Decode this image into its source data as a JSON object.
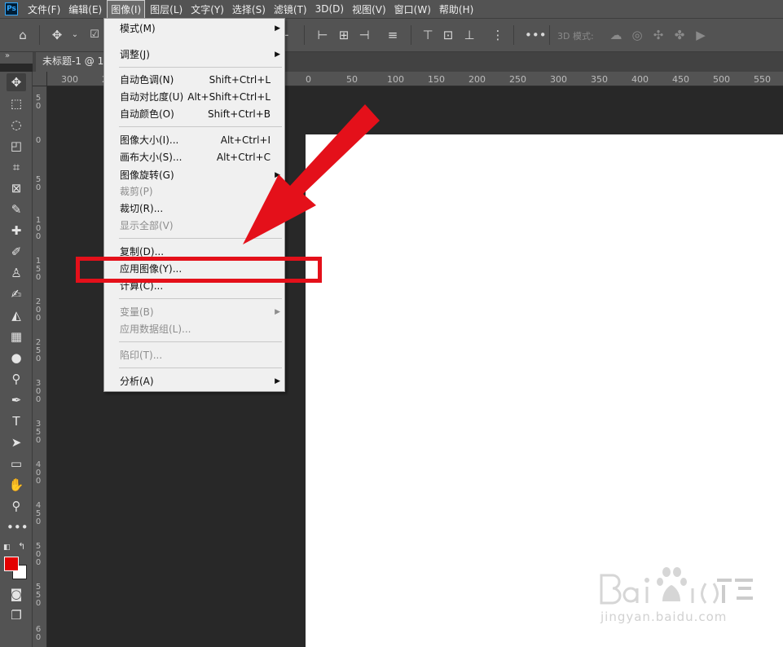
{
  "app": {
    "logo": "Ps"
  },
  "menubar": {
    "items": [
      "文件(F)",
      "编辑(E)",
      "图像(I)",
      "图层(L)",
      "文字(Y)",
      "选择(S)",
      "滤镜(T)",
      "3D(D)",
      "视图(V)",
      "窗口(W)",
      "帮助(H)"
    ],
    "active_index": 2
  },
  "options_bar": {
    "mode3d_label": "3D 模式:"
  },
  "tab": {
    "title": "未标题-1 @ 10"
  },
  "panel_toggle": "»",
  "hruler_labels": [
    "300",
    "250",
    "200",
    "150",
    "100",
    "50",
    "0",
    "50",
    "100",
    "150",
    "200",
    "250",
    "300",
    "350",
    "400",
    "450",
    "500",
    "550"
  ],
  "vruler_labels": [
    "5 0",
    "0",
    "5 0",
    "1 0 0",
    "1 5 0",
    "2 0 0",
    "2 5 0",
    "3 0 0",
    "3 5 0",
    "4 0 0",
    "4 5 0",
    "5 0 0",
    "5 5 0",
    "6 0"
  ],
  "image_menu": {
    "mode": "模式(M)",
    "adjust": "调整(J)",
    "auto_tone": "自动色调(N)",
    "auto_tone_sc": "Shift+Ctrl+L",
    "auto_contrast": "自动对比度(U)",
    "auto_contrast_sc": "Alt+Shift+Ctrl+L",
    "auto_color": "自动颜色(O)",
    "auto_color_sc": "Shift+Ctrl+B",
    "image_size": "图像大小(I)...",
    "image_size_sc": "Alt+Ctrl+I",
    "canvas_size": "画布大小(S)...",
    "canvas_size_sc": "Alt+Ctrl+C",
    "rotation": "图像旋转(G)",
    "crop": "裁剪(P)",
    "trim": "裁切(R)...",
    "reveal_all": "显示全部(V)",
    "duplicate": "复制(D)...",
    "apply_image": "应用图像(Y)...",
    "calculations": "计算(C)...",
    "variables": "变量(B)",
    "apply_dataset": "应用数据组(L)...",
    "trap": "陷印(T)...",
    "analysis": "分析(A)"
  },
  "colors": {
    "foreground": "#e30000",
    "background": "#ffffff",
    "annotation": "#e4101a"
  },
  "watermark": {
    "text": "jingyan.baidu.com"
  }
}
